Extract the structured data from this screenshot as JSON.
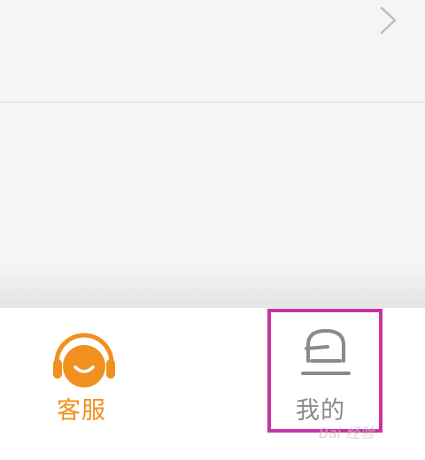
{
  "tab_bar": {
    "service_label": "客服",
    "mine_label": "我的"
  },
  "colors": {
    "service_accent": "#f0901e",
    "mine_gray": "#8a8a8a",
    "highlight": "#c7349f"
  },
  "icons": {
    "row_chevron": "chevron-right-icon",
    "service": "headset-smile-icon",
    "mine": "profile-face-icon"
  },
  "watermark": "Bai 经验"
}
